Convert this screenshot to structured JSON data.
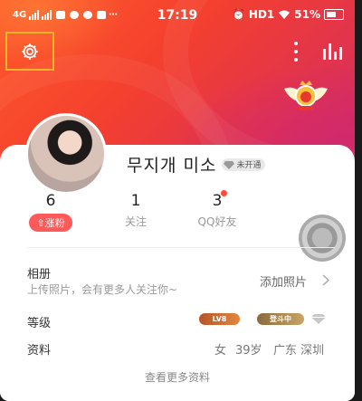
{
  "status_bar": {
    "network": "4G",
    "time": "17:19",
    "hd": "HD1",
    "battery": "51%"
  },
  "profile": {
    "name": "무지개 미소",
    "vip_badge": "未开通"
  },
  "stats": [
    {
      "value": "6",
      "label": "涨粉",
      "style": "pill"
    },
    {
      "value": "1",
      "label": "关注",
      "style": "plain"
    },
    {
      "value": "3",
      "label": "QQ好友",
      "style": "plain",
      "dot": true
    }
  ],
  "album": {
    "title": "相册",
    "subtitle": "上传照片，会有更多人关注你~",
    "action": "添加照片"
  },
  "level": {
    "title": "等级",
    "badges": [
      "LV8",
      "登斗中"
    ]
  },
  "info": {
    "title": "资料",
    "values": [
      "女",
      "39岁",
      "广东 深圳"
    ],
    "more": "查看更多资料"
  },
  "colors": {
    "accent": "#f4402e",
    "highlight_box": "#f0b42a",
    "pill": "#ff5a5a"
  },
  "icons": [
    "settings-gear-icon",
    "more-vertical-icon",
    "bar-chart-icon",
    "wings-emblem-icon",
    "diamond-icon",
    "chevron-right-icon"
  ]
}
